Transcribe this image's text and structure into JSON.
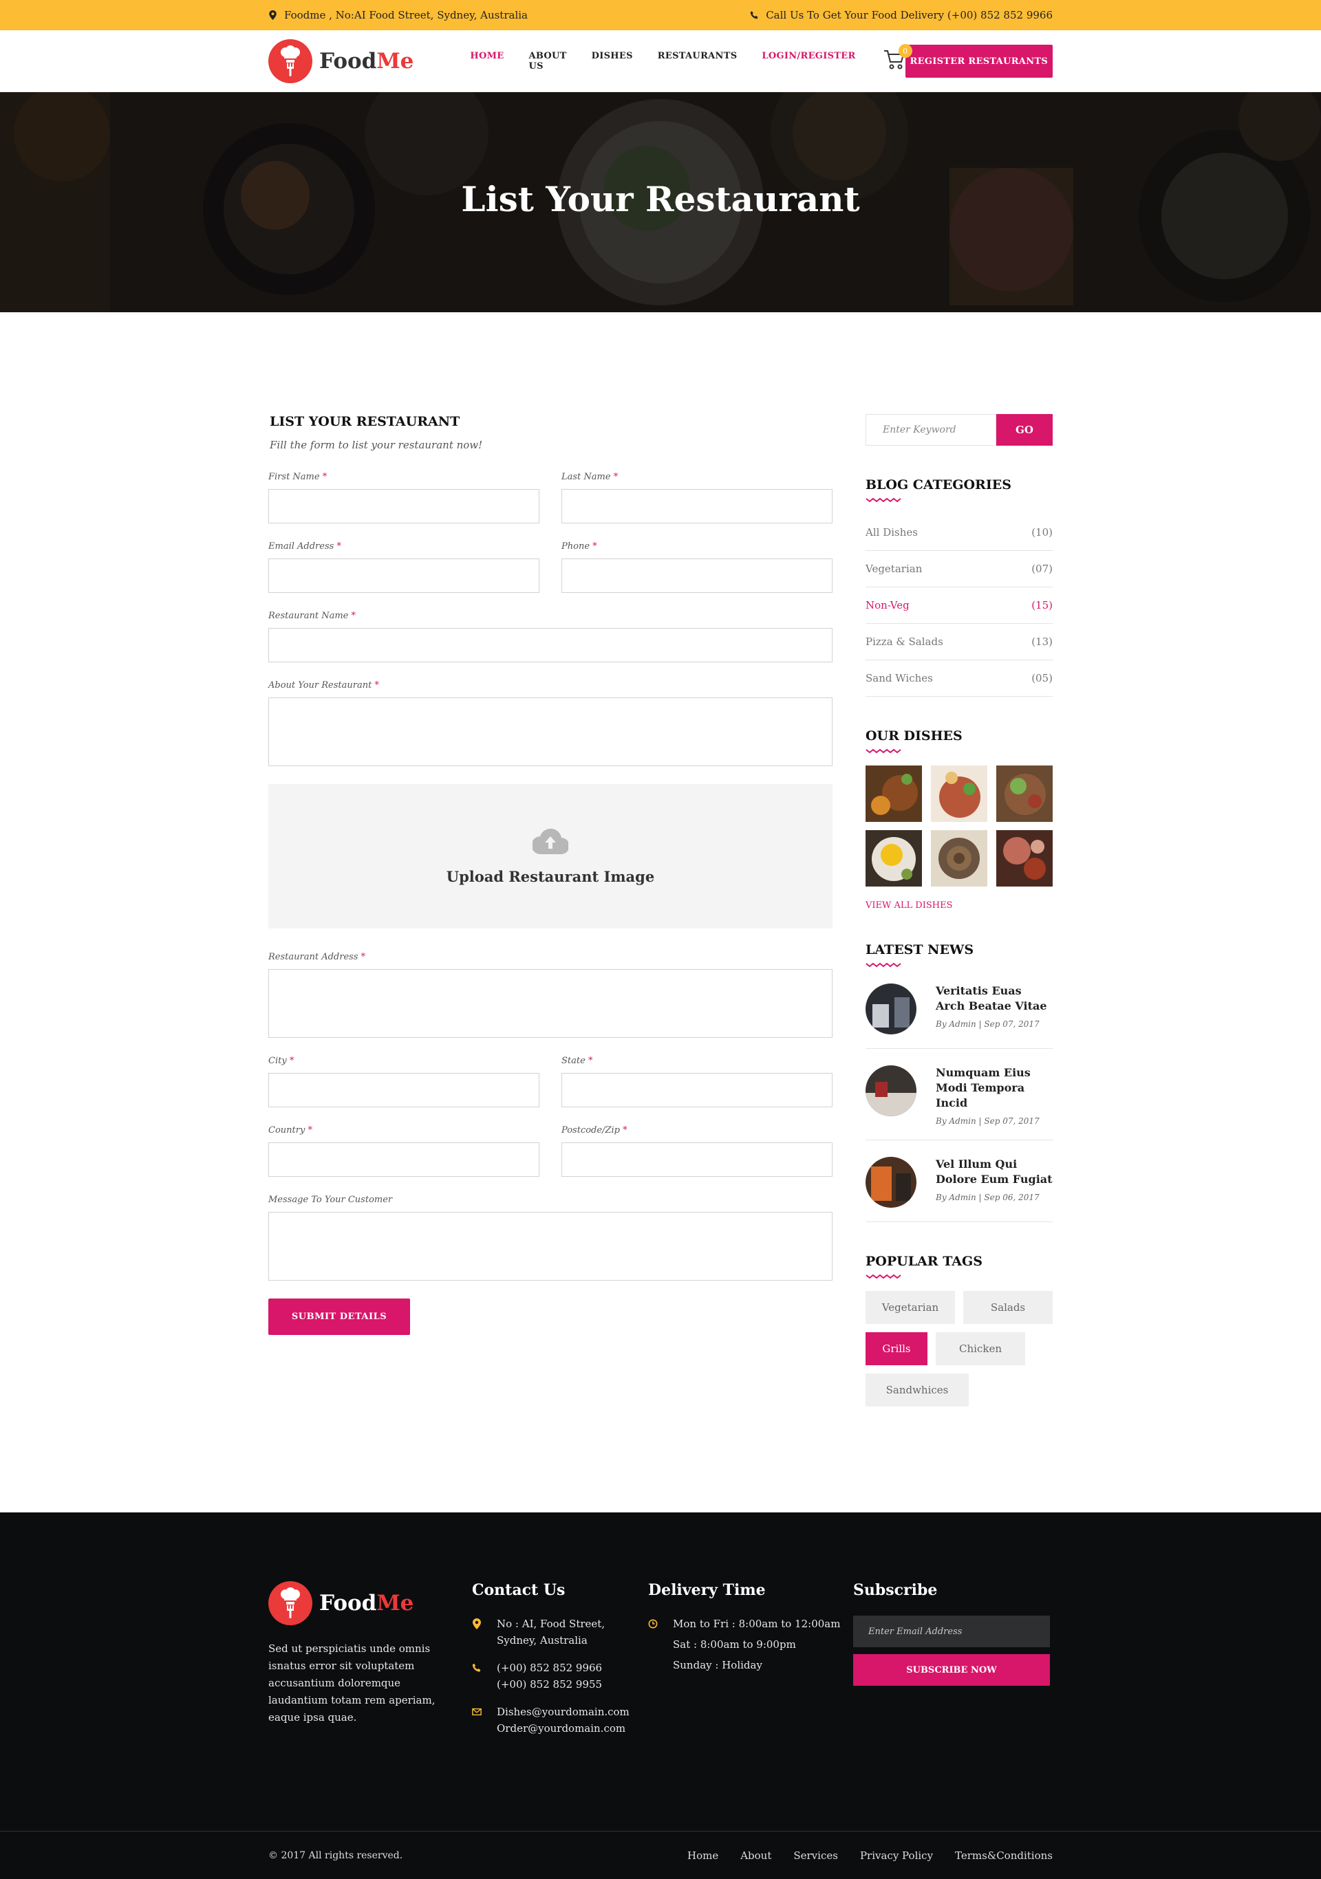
{
  "topbar": {
    "address": "Foodme , No:AI Food Street, Sydney, Australia",
    "call": "Call Us To Get Your Food Delivery  (+00) 852 852 9966"
  },
  "brand": {
    "name_part1": "Food",
    "name_part2": "Me",
    "accent": "#ea3a3a",
    "primary": "#d8166a",
    "yellow": "#fcbc34"
  },
  "nav": {
    "items": [
      "HOME",
      "ABOUT US",
      "DISHES",
      "RESTAURANTS",
      "LOGIN/REGISTER"
    ],
    "cart_count": "0",
    "register_btn": "REGISTER RESTAURANTS"
  },
  "hero": {
    "title": "List Your Restaurant"
  },
  "form": {
    "heading": "LIST YOUR RESTAURANT",
    "subheading": "Fill the form to list your restaurant now!",
    "first_name": "First Name",
    "last_name": "Last Name",
    "email": "Email Address",
    "phone": "Phone",
    "restaurant_name": "Restaurant Name",
    "about": "About Your Restaurant",
    "upload": "Upload Restaurant Image",
    "address": "Restaurant Address",
    "city": "City",
    "state": "State",
    "country": "Country",
    "postcode": "Postcode/Zip",
    "message": "Message To Your Customer",
    "required_mark": "*",
    "submit": "SUBMIT DETAILS"
  },
  "sidebar": {
    "search_placeholder": "Enter Keyword",
    "search_btn": "GO",
    "categories_title": "BLOG CATEGORIES",
    "categories": [
      {
        "name": "All Dishes",
        "count": "(10)"
      },
      {
        "name": "Vegetarian",
        "count": "(07)"
      },
      {
        "name": "Non-Veg",
        "count": "(15)"
      },
      {
        "name": "Pizza & Salads",
        "count": "(13)"
      },
      {
        "name": "Sand Wiches",
        "count": "(05)"
      }
    ],
    "dishes_title": "OUR DISHES",
    "view_all": "VIEW ALL DISHES",
    "news_title": "LATEST NEWS",
    "news": [
      {
        "title": "Veritatis Euas Arch Beatae Vitae",
        "meta": "By Admin | Sep 07, 2017"
      },
      {
        "title": "Numquam Eius Modi Tempora Incid",
        "meta": "By Admin | Sep 07, 2017"
      },
      {
        "title": "Vel Illum Qui Dolore Eum Fugiat",
        "meta": "By Admin | Sep 06, 2017"
      }
    ],
    "tags_title": "POPULAR TAGS",
    "tags": [
      "Vegetarian",
      "Salads",
      "Grills",
      "Chicken",
      "Sandwhices"
    ]
  },
  "footer": {
    "about": "Sed ut perspiciatis unde omnis isnatus error sit voluptatem accusantium doloremque laudantium totam rem aperiam, eaque ipsa quae.",
    "contact_title": "Contact Us",
    "addr1": "No : AI, Food Street,",
    "addr2": "Sydney, Australia",
    "phone1": "(+00) 852 852 9966",
    "phone2": "(+00) 852 852 9955",
    "mail1": "Dishes@yourdomain.com",
    "mail2": "Order@yourdomain.com",
    "delivery_title": "Delivery Time",
    "time1": "Mon to Fri : 8:00am to 12:00am",
    "time2": "Sat : 8:00am to 9:00pm",
    "time3": "Sunday : Holiday",
    "subscribe_title": "Subscribe",
    "email_placeholder": "Enter Email Address",
    "subscribe_btn": "SUBSCRIBE NOW",
    "copyright": "© 2017 All rights reserved.",
    "links": [
      "Home",
      "About",
      "Services",
      "Privacy Policy",
      "Terms&Conditions"
    ]
  }
}
